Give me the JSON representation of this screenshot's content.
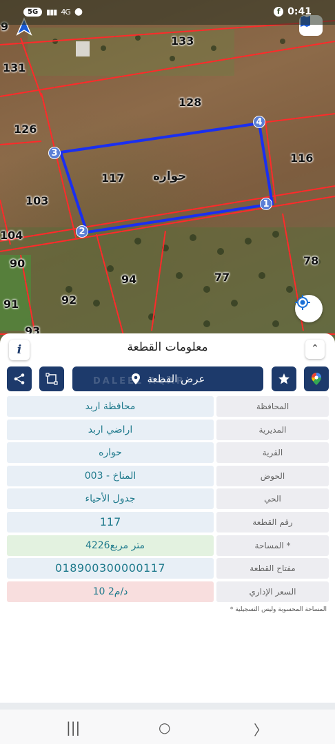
{
  "status_bar": {
    "time": "0:41",
    "left_indicator": "5G",
    "signal_text": "4G",
    "icons": [
      "facebook-icon",
      "location-icon",
      "signal-icon"
    ]
  },
  "map": {
    "parcels": [
      "133",
      "131",
      "128",
      "126",
      "116",
      "117",
      "103",
      "104",
      "90",
      "94",
      "77",
      "78",
      "91",
      "92",
      "93",
      "9"
    ],
    "village_label": "حواره",
    "vertices": [
      "1",
      "2",
      "3",
      "4"
    ],
    "colors": {
      "boundary": "#ff2a2a",
      "selected_parcel": "#1a2ff0",
      "vertex": "#5b7fd6"
    }
  },
  "sheet": {
    "title": "معلومات القطعة",
    "info_symbol": "i",
    "collapse_symbol": "⌃",
    "show_plot_label": "عرض القطعة",
    "watermark": "DALEEL AQAR",
    "rows": [
      {
        "label": "المحافظة",
        "value": "محافظة اربد"
      },
      {
        "label": "المديرية",
        "value": "اراضي اربد"
      },
      {
        "label": "القرية",
        "value": "حواره"
      },
      {
        "label": "الحوض",
        "value": "المناخ - 003"
      },
      {
        "label": "الحي",
        "value": "جدول الأحياء"
      },
      {
        "label": "رقم القطعة",
        "value": "117"
      }
    ],
    "area": {
      "label": "المساحة *",
      "number": "4226",
      "unit": "متر مربع"
    },
    "plot_key": {
      "label": "مفتاح القطعة",
      "value": "018900300000117"
    },
    "price": {
      "label": "السعر الإداري",
      "value": "10 د/م2"
    },
    "footnote": "* المساحة المحسوبة وليس التسجيلية",
    "colors": {
      "primary": "#1d3a6b",
      "value_text": "#1f7a8c",
      "area_bg": "#e3f2e0",
      "price_bg": "#f8dede"
    }
  },
  "nav": {
    "recents": "|||",
    "home": "○",
    "back": "〉"
  }
}
